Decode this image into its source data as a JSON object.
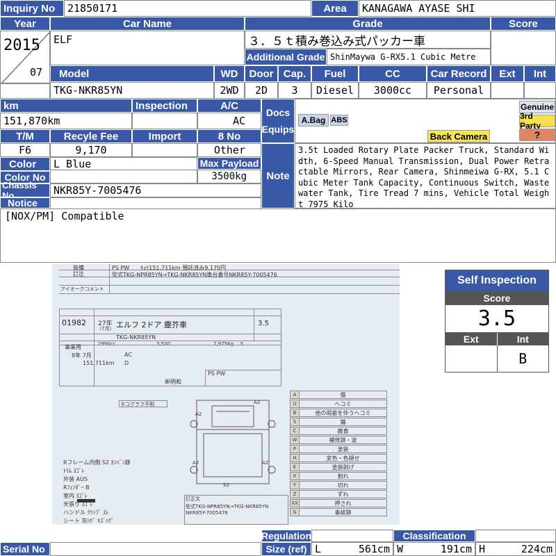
{
  "labels": {
    "inquiry_no": "Inquiry No",
    "area": "Area",
    "year": "Year",
    "car_name": "Car Name",
    "grade": "Grade",
    "score": "Score",
    "additional_grade": "Additional Grade",
    "model": "Model",
    "wd": "WD",
    "door": "Door",
    "cap": "Cap.",
    "fuel": "Fuel",
    "cc": "CC",
    "car_record": "Car Record",
    "ext": "Ext",
    "int": "Int",
    "km": "km",
    "inspection": "Inspection",
    "ac": "A/C",
    "docs": "Docs",
    "equips": "Equips",
    "tm": "T/M",
    "recycle_fee": "Recyle Fee",
    "import": "Import",
    "eight_no": "8 No",
    "color": "Color",
    "max_payload": "Max Payload",
    "color_no": "Color No",
    "note": "Note",
    "chassis_no": "Chassis No",
    "notice": "Notice",
    "serial_no": "Serial No",
    "regulation": "Regulation",
    "classification": "Classification",
    "size_ref": "Size (ref)",
    "size_l": "L",
    "size_w": "W",
    "size_h": "H"
  },
  "values": {
    "inquiry_no": "21850171",
    "area": "KANAGAWA AYASE SHI",
    "year": "2015",
    "month": "07",
    "car_name": "ELF",
    "grade": "３．５ｔ積み巻込み式パッカー車",
    "additional_grade": "ShinMaywa G-RX5.1 Cubic Metre",
    "model": "TKG-NKR85YN",
    "wd": "2WD",
    "door": "2D",
    "cap": "3",
    "fuel": "Diesel",
    "cc": "3000cc",
    "car_record": "Personal",
    "km": "151,870km",
    "ac": "AC",
    "tm": "F6",
    "recycle_fee": "9,170",
    "eight_no": "Other",
    "color": "L Blue",
    "max_payload": "3500kg",
    "chassis_no": "NKR85Y-7005476",
    "note": "3.5t Loaded Rotary Plate Packer Truck, Standard Width, 6-Speed Manual Transmission, Dual Power Retractable Mirrors, Rear Camera, Shinmeiwa G-RX, 5.1 Cubic Meter Tank Capacity, Continuous Switch, Wastewater Tank, Tire Tread 7 mins, Vehicle Total Weight 7975 Kilo",
    "notice": "[NOX/PM] Compatible",
    "size_l": "561cm",
    "size_w": "191cm",
    "size_h": "224cm"
  },
  "equips": {
    "abag": "A.Bag",
    "abs": "ABS",
    "back_camera": "Back Camera",
    "genuine": "Genuine",
    "third_party": "3rd Party",
    "unknown": "?"
  },
  "self_inspection": {
    "title": "Self Inspection",
    "score_label": "Score",
    "score": "3.5",
    "ext_label": "Ext",
    "int_label": "Int",
    "ext": "",
    "int": "B"
  },
  "sheet": {
    "equip_label": "装備",
    "equip_val": "PS PW　　ｷｮﾘ151,711km 預託済み9,170円",
    "correction_label": "訂正",
    "correction_val": "型式TKG-NPR85YN→TKG-NKR85YN車台番号NKR85Y-7005476",
    "comment_label": "アイオークコメント",
    "lot": "01982",
    "year": "27年",
    "month": "（7月）",
    "name": "エルフ 2ドア 塵芥車",
    "score": "3.5",
    "model": "TKG-NKR85YN",
    "cc": "2990cc",
    "payload": "3,500",
    "weight": "7,975Kg",
    "cap": "3",
    "business": "事業用",
    "expiry": "8年 7月",
    "km": "151,711km",
    "ac": "AC",
    "fuel": "D",
    "new_plate": "新明和",
    "equip_box": "PS PW",
    "tacho": "タコグラフ不明",
    "legend": [
      [
        "A",
        "傷"
      ],
      [
        "U",
        "ヘコミ"
      ],
      [
        "B",
        "他の瑕疵を伴うヘコミ"
      ],
      [
        "S",
        "錆"
      ],
      [
        "C",
        "腐食"
      ],
      [
        "W",
        "補修跡・波"
      ],
      [
        "P",
        "塗装"
      ],
      [
        "H",
        "変色・色褪せ"
      ],
      [
        "E",
        "塗装剥げ"
      ],
      [
        "X",
        "割れ"
      ],
      [
        "Y",
        "切れ"
      ],
      [
        "Z",
        "ずれ"
      ],
      [
        "XX",
        "押され"
      ],
      [
        "G",
        "事故跡"
      ]
    ],
    "notes": [
      "Rフレーム内側 S2 ｶﾝﾊﾞﾝ跡",
      "ﾄﾘﾑ ﾖｺﾞﾚ",
      "外装 AUS",
      "Rﾌｪﾝﾀﾞｰ B",
      "室内 ﾖｺﾞﾚ",
      "天張り ﾖｺﾞﾚ",
      "ハンドル ｸﾘｯﾌﾟ ｽﾚ",
      "シート 灰ﾊｹﾞ ｷｽﾞﾊｹﾞ"
    ],
    "diagram_marks": [
      "A2",
      "A2",
      "A2",
      "S2",
      "A2"
    ],
    "corr_title": "訂正文",
    "corr_line1": "型式TKG-NPR85YN→TKG-NKR85YN",
    "corr_line2": "NKR85Y-7005476"
  },
  "colors": {
    "header_blue": "#3a58a8",
    "doc_yellow": "#f6e35c",
    "genuine_bg": "#dbe3f0",
    "third_party_bg": "#f7e04a",
    "unknown_bg": "#e08560",
    "equip_blue_bg": "#c9d5e8"
  }
}
